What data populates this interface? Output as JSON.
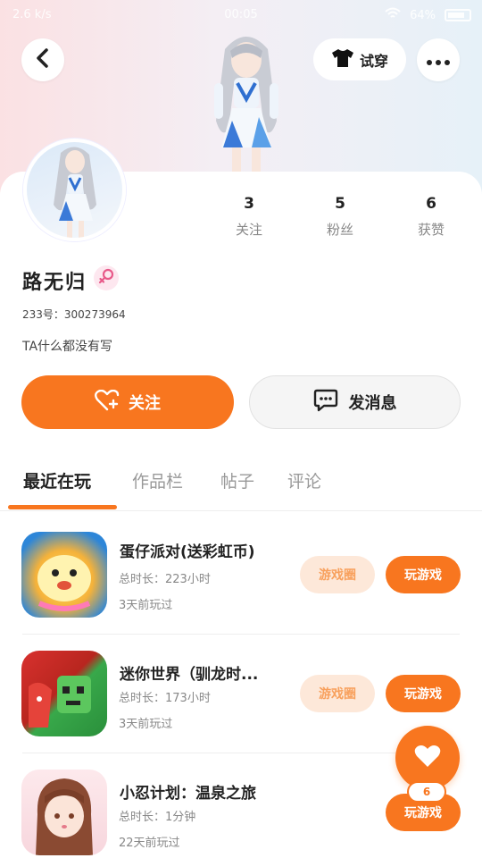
{
  "status_bar": {
    "left": "2.6 k/s",
    "time": "00:05",
    "battery": "64%"
  },
  "header": {
    "try_label": "试穿"
  },
  "stats": [
    {
      "count": "3",
      "label": "关注"
    },
    {
      "count": "5",
      "label": "粉丝"
    },
    {
      "count": "6",
      "label": "获赞"
    }
  ],
  "profile": {
    "name": "路无归",
    "uid": "233号：300273964",
    "bio": "TA什么都没有写"
  },
  "actions": {
    "follow_label": "关注",
    "message_label": "发消息"
  },
  "tabs": [
    {
      "label": "最近在玩",
      "active": true
    },
    {
      "label": "作品栏",
      "active": false
    },
    {
      "label": "帖子",
      "active": false
    },
    {
      "label": "评论",
      "active": false
    }
  ],
  "games": [
    {
      "title": "蛋仔派对(送彩虹币)",
      "playtime": "总时长：223小时",
      "last_played": "3天前玩过",
      "circle_label": "游戏圈",
      "play_label": "玩游戏"
    },
    {
      "title": "迷你世界（驯龙时...",
      "playtime": "总时长：173小时",
      "last_played": "3天前玩过",
      "circle_label": "游戏圈",
      "play_label": "玩游戏"
    },
    {
      "title": "小忍计划：温泉之旅",
      "playtime": "总时长：1分钟",
      "last_played": "22天前玩过",
      "play_label": "玩游戏"
    }
  ],
  "like_fab": {
    "count": "6"
  },
  "colors": {
    "accent": "#f8761f",
    "circle_bg": "#fde8d9",
    "female": "#e85a8a"
  }
}
